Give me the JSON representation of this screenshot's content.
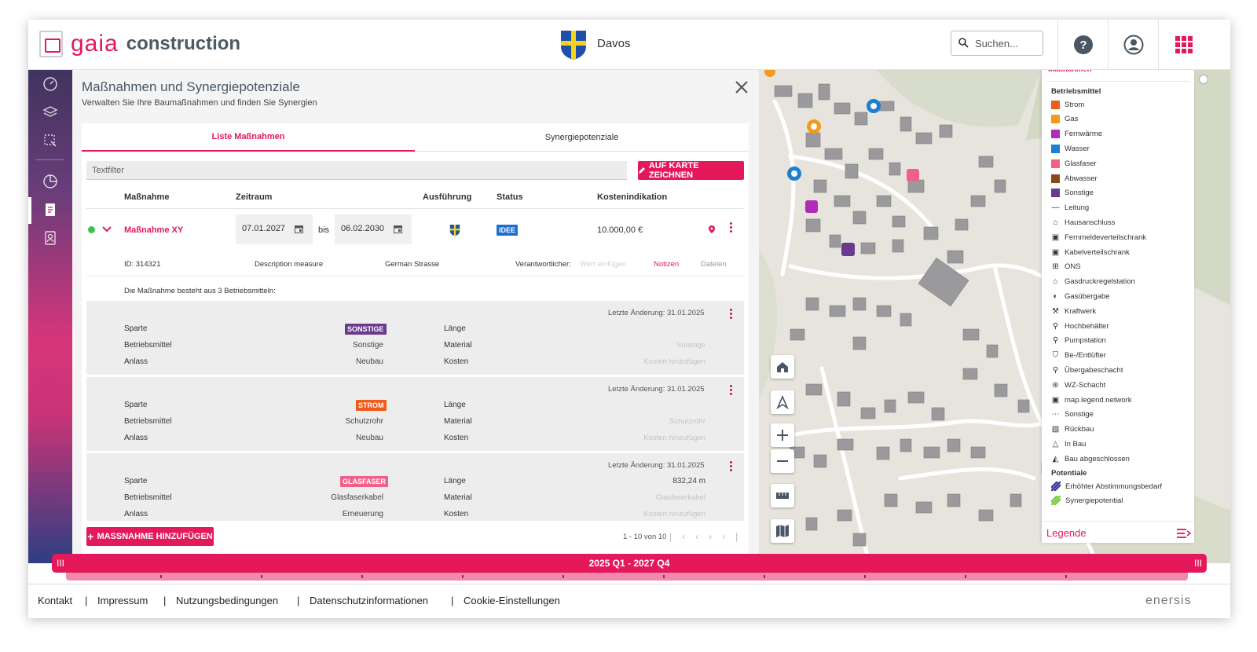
{
  "header": {
    "brand_prefix": "GAIA",
    "brand_suffix": "construction",
    "city": "Davos",
    "search_placeholder": "Suchen..."
  },
  "panel": {
    "title": "Maßnahmen und Synergiepotenziale",
    "subtitle": "Verwalten Sie Ihre Baumaßnahmen und finden Sie Synergien",
    "tabs": [
      "Liste Maßnahmen",
      "Synergiepotenziale"
    ],
    "filter_placeholder": "Textfilter",
    "draw_button": "AUF KARTE ZEICHNEN",
    "columns": [
      "Maßnahme",
      "Zeitraum",
      "Ausführung",
      "Status",
      "Kostenindikation"
    ],
    "row": {
      "name": "Maßnahme XY",
      "date_from": "07.01.2027",
      "bis": "bis",
      "date_to": "06.02.2030",
      "status": "IDEE",
      "cost": "10.000,00 €",
      "id": "ID: 314321",
      "description": "Description measure",
      "street": "German Strasse",
      "responsible_label": "Verantwortlicher:",
      "responsible_placeholder": "Wert einfügen",
      "notes": "Notizen",
      "files": "Dateien",
      "summary": "Die Maßnahme besteht aus 3 Betriebsmitteln:"
    },
    "labels": {
      "sparte": "Sparte",
      "betriebsmittel": "Betriebsmittel",
      "anlass": "Anlass",
      "laenge": "Länge",
      "material": "Material",
      "kosten": "Kosten",
      "kosten_add": "Kosten hinzufügen"
    },
    "sub_items": [
      {
        "changed": "Letzte Änderung: 31.01.2025",
        "badge": "SONSTIGE",
        "badge_color": "#6b3a8c",
        "betriebsmittel": "Sonstige",
        "anlass": "Neubau",
        "laenge": "",
        "material": "Sonstige"
      },
      {
        "changed": "Letzte Änderung: 31.01.2025",
        "badge": "STROM",
        "badge_color": "#f05a1a",
        "betriebsmittel": "Schutzrohr",
        "anlass": "Neubau",
        "laenge": "",
        "material": "Schutzrohr"
      },
      {
        "changed": "Letzte Änderung: 31.01.2025",
        "badge": "GLASFASER",
        "badge_color": "#f0608a",
        "betriebsmittel": "Glasfaserkabel",
        "anlass": "Erneuerung",
        "laenge": "832,24 m",
        "material": "Glasfaserkabel"
      }
    ],
    "add_button": "MASSNAHME HINZUFÜGEN",
    "pager": "1 - 10 von 10"
  },
  "legend": {
    "top_label": "Maßnahmen",
    "section1": "Betriebsmittel",
    "items": [
      {
        "label": "Strom",
        "color": "#f05a1a"
      },
      {
        "label": "Gas",
        "color": "#f59a1b"
      },
      {
        "label": "Fernwärme",
        "color": "#b02bb8"
      },
      {
        "label": "Wasser",
        "color": "#1c7fd0"
      },
      {
        "label": "Glasfaser",
        "color": "#f0608a"
      },
      {
        "label": "Abwasser",
        "color": "#8a4a18"
      },
      {
        "label": "Sonstige",
        "color": "#6b3a8c"
      },
      {
        "label": "Leitung",
        "color": ""
      },
      {
        "label": "Hausanschluss",
        "color": ""
      },
      {
        "label": "Fernmeldeverteilschrank",
        "color": ""
      },
      {
        "label": "Kabelverteilschrank",
        "color": ""
      },
      {
        "label": "ONS",
        "color": ""
      },
      {
        "label": "Gasdruckregelstation",
        "color": ""
      },
      {
        "label": "Gasübergabe",
        "color": ""
      },
      {
        "label": "Kraftwerk",
        "color": ""
      },
      {
        "label": "Hochbehälter",
        "color": ""
      },
      {
        "label": "Pumpstation",
        "color": ""
      },
      {
        "label": "Be-/Entlüfter",
        "color": ""
      },
      {
        "label": "Übergabeschacht",
        "color": ""
      },
      {
        "label": "WZ-Schacht",
        "color": ""
      },
      {
        "label": "map.legend.network",
        "color": ""
      },
      {
        "label": "Sonstige",
        "color": ""
      },
      {
        "label": "Rückbau",
        "color": ""
      },
      {
        "label": "In Bau",
        "color": ""
      },
      {
        "label": "Bau abgeschlossen",
        "color": ""
      }
    ],
    "section2": "Potentiale",
    "potentials": [
      {
        "label": "Erhöhter Abstimmungsbedarf",
        "color": "#3a3a9c"
      },
      {
        "label": "Synergiepotential",
        "color": "#7ac943"
      }
    ],
    "footer": "Legende"
  },
  "timeline": {
    "label": "2025 Q1 - 2027 Q4"
  },
  "footer": {
    "links": [
      "Kontakt",
      "Impressum",
      "Nutzungsbedingungen",
      "Datenschutzinformationen",
      "Cookie-Einstellungen"
    ],
    "brand": "enersis"
  },
  "colors": {
    "accent": "#e3195b"
  }
}
